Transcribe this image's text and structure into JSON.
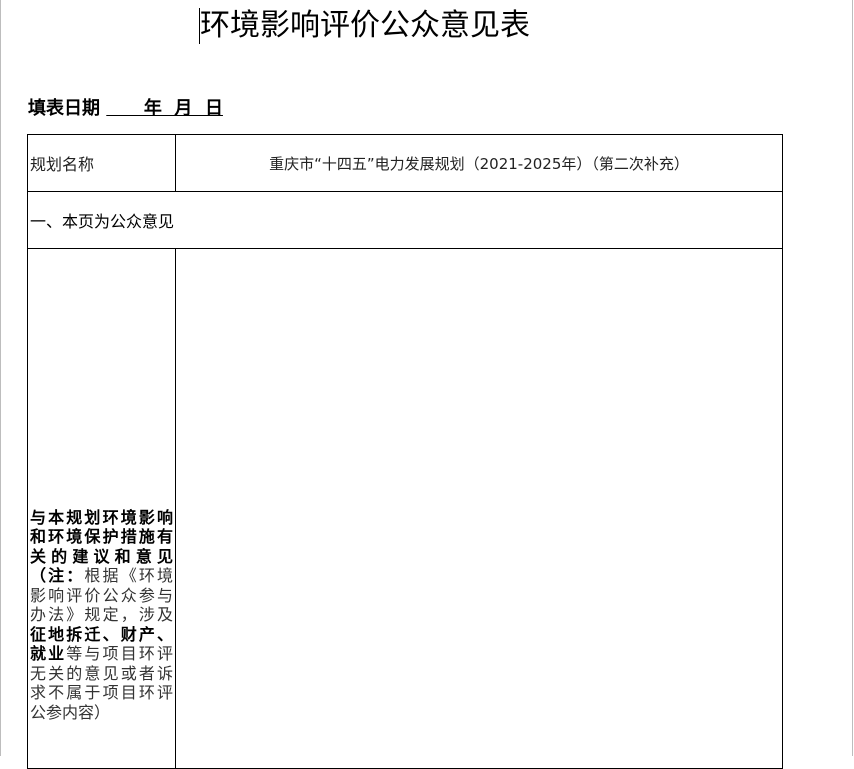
{
  "document": {
    "title": "环境影响评价公众意见表",
    "date_label": "填表日期",
    "date_blank": "      年  月  日"
  },
  "table": {
    "plan_name_label": "规划名称",
    "plan_name_value": "重庆市“十四五”电力发展规划（2021-2025年）（第二次补充）",
    "section_heading": "一、本页为公众意见",
    "opinion_label_part1": "与本规划环境影响和环境保护措施有关的建议和意见",
    "opinion_label_part2": "（注：",
    "opinion_label_part3": "根据《环境影响评价公众参与办法》规定，涉及",
    "opinion_label_part4": "征地拆迁、财产、就业",
    "opinion_label_part5": "等与项目环评无关的意见或者诉求不属于项目环评公参内容）",
    "opinion_value": ""
  }
}
